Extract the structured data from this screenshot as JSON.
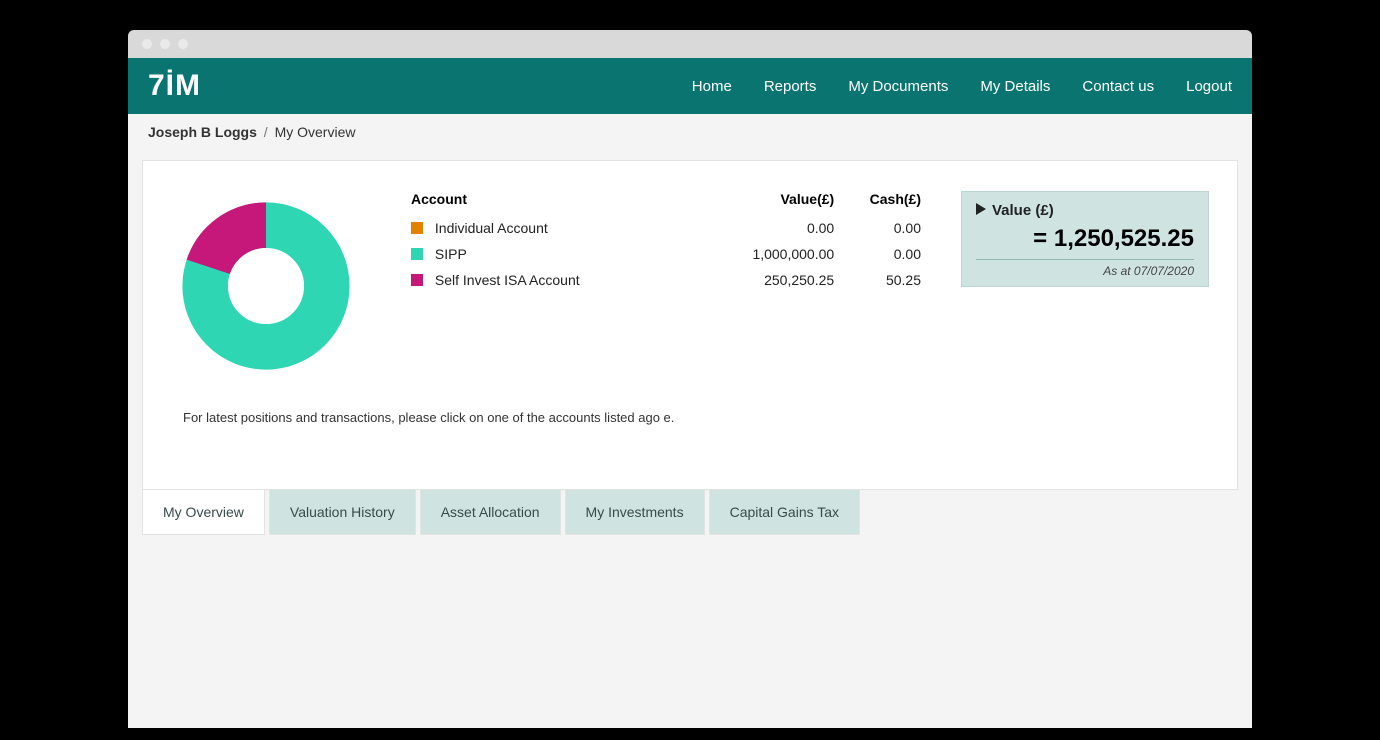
{
  "logo_text": "7İM",
  "nav": {
    "home": "Home",
    "reports": "Reports",
    "documents": "My Documents",
    "details": "My Details",
    "contact": "Contact us",
    "logout": "Logout"
  },
  "breadcrumb": {
    "name": "Joseph B Loggs",
    "sep": "/",
    "page": "My Overview"
  },
  "table": {
    "head_account": "Account",
    "head_value": "Value(£)",
    "head_cash": "Cash(£)",
    "rows": [
      {
        "label": "Individual Account",
        "value": "0.00",
        "cash": "0.00",
        "color": "#e28200"
      },
      {
        "label": "SIPP",
        "value": "1,000,000.00",
        "cash": "0.00",
        "color": "#2fd6b4"
      },
      {
        "label": "Self Invest ISA Account",
        "value": "250,250.25",
        "cash": "50.25",
        "color": "#c6177a"
      }
    ]
  },
  "valuebox": {
    "title": "Value (£)",
    "amount": "= 1,250,525.25",
    "asat": "As at 07/07/2020"
  },
  "note": "For latest positions and transactions, please click on one of the accounts listed ago e.",
  "tabs": {
    "overview": "My Overview",
    "history": "Valuation History",
    "allocation": "Asset Allocation",
    "investments": "My Investments",
    "cgt": "Capital Gains Tax"
  },
  "chart_data": {
    "type": "pie",
    "title": "",
    "series": [
      {
        "name": "Individual Account",
        "value": 0.0,
        "color": "#e28200"
      },
      {
        "name": "SIPP",
        "value": 1000000.0,
        "color": "#2fd6b4"
      },
      {
        "name": "Self Invest ISA Account",
        "value": 250250.25,
        "color": "#c6177a"
      }
    ],
    "donut": true
  }
}
